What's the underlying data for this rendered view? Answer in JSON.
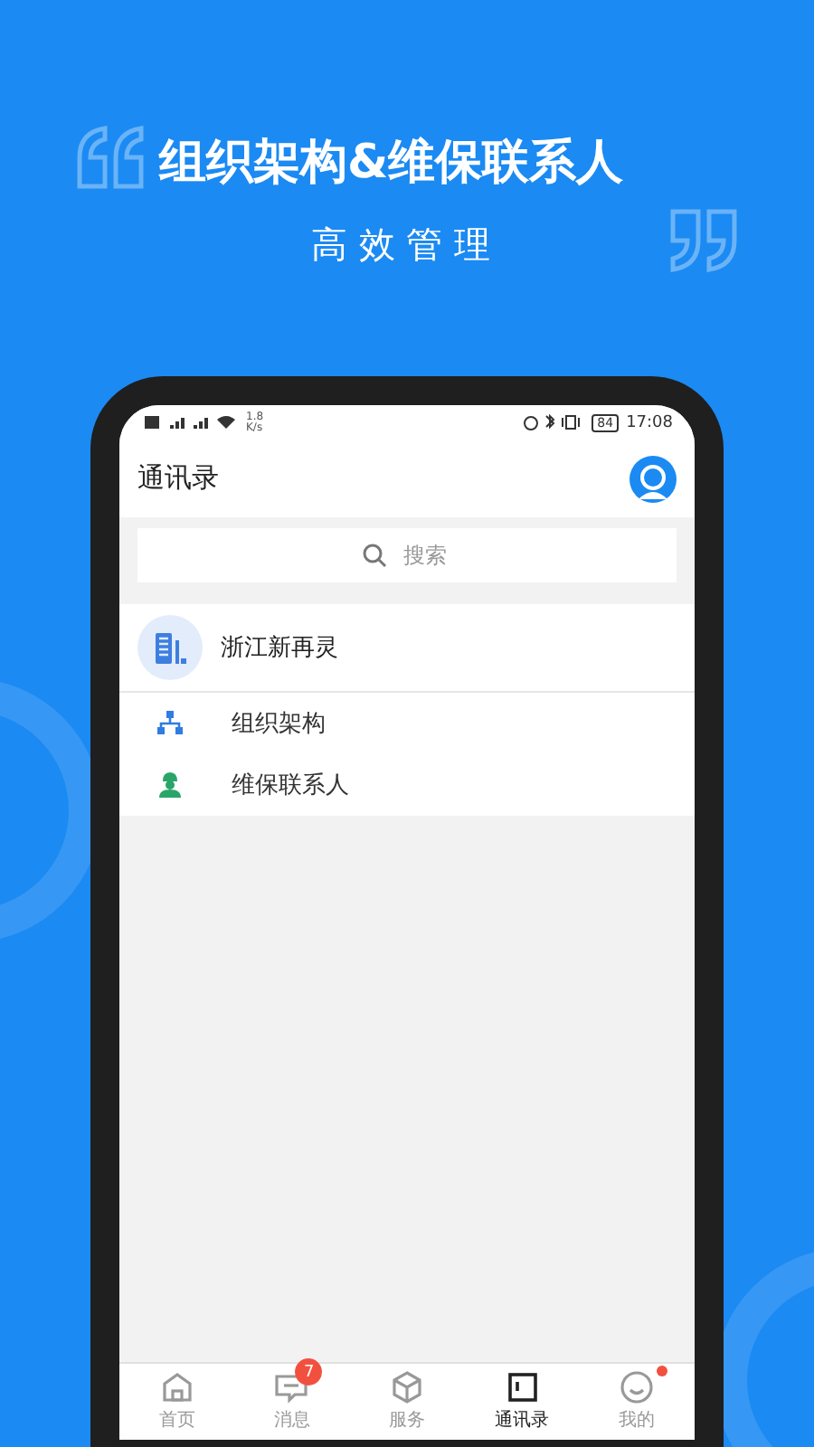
{
  "banner": {
    "title": "组织架构&维保联系人",
    "subtitle": "高 效 管 理"
  },
  "status_bar": {
    "speed": "1.8",
    "speed_unit": "K/s",
    "battery": "84",
    "time": "17:08"
  },
  "header": {
    "title": "通讯录"
  },
  "search": {
    "placeholder": "搜索"
  },
  "organization": {
    "name": "浙江新再灵"
  },
  "items": [
    {
      "kind": "org",
      "label": "组织架构"
    },
    {
      "kind": "contact",
      "label": "维保联系人"
    }
  ],
  "tabs": [
    {
      "kind": "home",
      "label": "首页",
      "selected": false
    },
    {
      "kind": "message",
      "label": "消息",
      "selected": false,
      "badge": "7"
    },
    {
      "kind": "service",
      "label": "服务",
      "selected": false
    },
    {
      "kind": "contacts",
      "label": "通讯录",
      "selected": true
    },
    {
      "kind": "me",
      "label": "我的",
      "selected": false,
      "dot": true
    }
  ]
}
